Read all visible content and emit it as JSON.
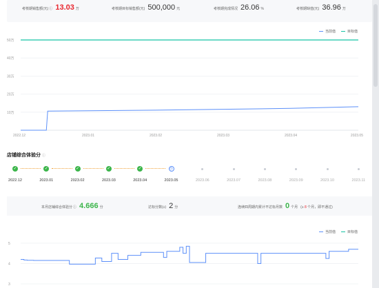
{
  "metrics": [
    {
      "label": "考核期销售额(元)",
      "value": "13.03",
      "unit": "万",
      "highlight": true,
      "has_help": true
    },
    {
      "label": "考核期目标销售额(元)",
      "value": "500,000",
      "unit": "元",
      "highlight": false,
      "has_help": false
    },
    {
      "label": "考核期完成情况",
      "value": "26.06",
      "unit": "%",
      "highlight": false,
      "has_help": false
    },
    {
      "label": "考核期缺值(元)",
      "value": "36.96",
      "unit": "万",
      "highlight": false,
      "has_help": false
    }
  ],
  "legend": {
    "current": "当前值",
    "target": "目标值"
  },
  "colors": {
    "current": "#5b8ff9",
    "target": "#13c2a3",
    "done": "#3bb54a",
    "alert": "#e8262e"
  },
  "chart_data": [
    {
      "type": "line",
      "ylim": [
        0,
        50
      ],
      "ytick_labels": [
        "10万",
        "20万",
        "30万",
        "40万",
        "50万"
      ],
      "ytick_values": [
        10,
        20,
        30,
        40,
        50
      ],
      "x_labels": [
        "2022.12",
        "2023.01",
        "2023.02",
        "2023.03",
        "2023.04",
        "2023.05"
      ],
      "series": [
        {
          "name": "当前值",
          "x": [
            0,
            0.38,
            0.4,
            1,
            2,
            3,
            4,
            5
          ],
          "values": [
            0,
            0,
            10.6,
            10.8,
            11.1,
            11.6,
            12.1,
            13.03
          ]
        },
        {
          "name": "目标值",
          "x": [
            0,
            5
          ],
          "values": [
            50,
            50
          ]
        }
      ]
    },
    {
      "type": "line",
      "ylim": [
        3,
        5.2
      ],
      "ytick_labels": [
        "3",
        "4",
        "5"
      ],
      "ytick_values": [
        3,
        4,
        5
      ],
      "series": [
        {
          "name": "当前值",
          "values": [
            4.2,
            4.17,
            4.16,
            4.16,
            4.15,
            4.15,
            4.15,
            4.15,
            4.15,
            4.15,
            4.15,
            4.15,
            4.15,
            4.15,
            4.15,
            3.97,
            3.97,
            3.97,
            3.97,
            3.97,
            3.97,
            3.97,
            3.97,
            4.27,
            4.27,
            4.1,
            4.1,
            4.1,
            4.5,
            4.5,
            4.2,
            4.2,
            4.2,
            4.4,
            4.4,
            4.4,
            4.4,
            4.55,
            4.55,
            4.55,
            4.55,
            4.55,
            4.55,
            4.55,
            4.3,
            4.6,
            4.6,
            4.6,
            4.6,
            4.8,
            4.5,
            4.85,
            4.05,
            4.05,
            4.05,
            4.05,
            4.05,
            4.5,
            4.5,
            4.5,
            4.5,
            4.5,
            4.5,
            4.5,
            4.5,
            4.5,
            4.5,
            4.5,
            4.5,
            4.5,
            4.5,
            4.5,
            4.5,
            4.0,
            4.5,
            4.5,
            4.5,
            4.5,
            4.5,
            4.5,
            4.5,
            4.5,
            4.5,
            4.5,
            4.5,
            4.5,
            4.5,
            4.5,
            4.5,
            4.5,
            4.5,
            4.5,
            4.5,
            4.5,
            4.25,
            4.6,
            4.6,
            4.6,
            4.6,
            4.6,
            4.6,
            4.7,
            4.7,
            4.7,
            4.7
          ]
        }
      ]
    }
  ],
  "section_title": "店铺综合体验分",
  "timeline": [
    {
      "label": "2022.12",
      "state": "done"
    },
    {
      "label": "2023.01",
      "state": "done"
    },
    {
      "label": "2023.02",
      "state": "done"
    },
    {
      "label": "2023.03",
      "state": "done"
    },
    {
      "label": "2023.04",
      "state": "done"
    },
    {
      "label": "2023.05",
      "state": "current"
    },
    {
      "label": "2023.06",
      "state": "future"
    },
    {
      "label": "2023.07",
      "state": "future"
    },
    {
      "label": "2023.08",
      "state": "future"
    },
    {
      "label": "2023.09",
      "state": "future"
    },
    {
      "label": "2023.10",
      "state": "future"
    },
    {
      "label": "2023.11",
      "state": "future"
    }
  ],
  "score": {
    "label": "本月店铺综合体验分",
    "value": "4.666",
    "unit": "分",
    "pass_label": "达标分数(≥)",
    "pass_value": "2",
    "pass_unit": "分",
    "fail_label": "连续四周期内累计不达标月数",
    "fail_value": "0",
    "fail_unit": "个月",
    "fail_note_prefix": "(≥",
    "fail_note_red": "8",
    "fail_note_suffix": "个月，即不通过)"
  }
}
